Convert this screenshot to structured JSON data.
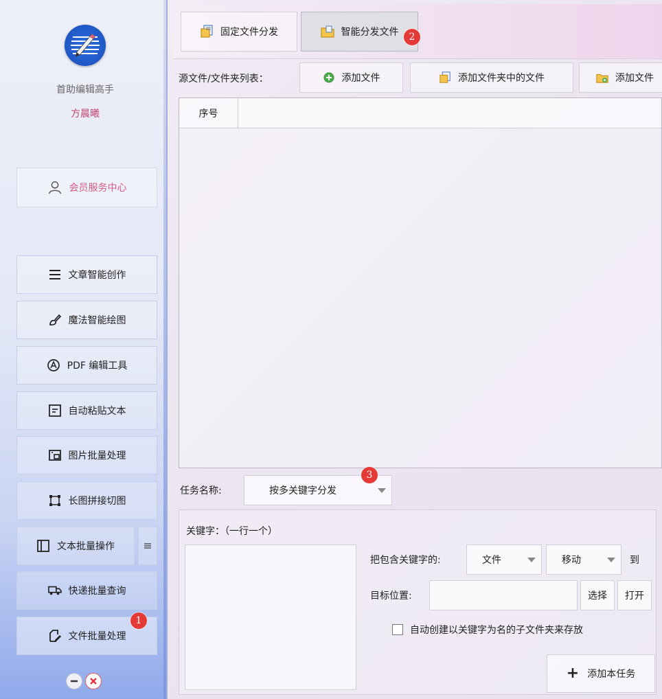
{
  "sidebar": {
    "app_name": "首助编辑高手",
    "user_name": "方晨曦",
    "member_center": "会员服务中心",
    "nav": [
      {
        "label": "文章智能创作",
        "icon": "list-icon"
      },
      {
        "label": "魔法智能绘图",
        "icon": "brush-icon"
      },
      {
        "label": "PDF 编辑工具",
        "icon": "pdf-icon"
      },
      {
        "label": "自动粘贴文本",
        "icon": "paste-icon"
      },
      {
        "label": "图片批量处理",
        "icon": "image-icon"
      },
      {
        "label": "长图拼接切图",
        "icon": "crop-icon"
      },
      {
        "label": "文本批量操作",
        "icon": "text-panel-icon"
      },
      {
        "label": "快递批量查询",
        "icon": "truck-icon"
      },
      {
        "label": "文件批量处理",
        "icon": "file-edit-icon"
      }
    ]
  },
  "tabs": [
    {
      "label": "固定文件分发",
      "active": false
    },
    {
      "label": "智能分发文件",
      "active": true
    }
  ],
  "toolbar": {
    "label": "源文件/文件夹列表：",
    "add_file": "添加文件",
    "add_folder_files": "添加文件夹中的文件",
    "add_folder": "添加文件"
  },
  "table": {
    "columns": [
      "序号"
    ],
    "rows": []
  },
  "task": {
    "label": "任务名称:",
    "value": "按多关键字分发"
  },
  "keywords": {
    "label": "关键字：（一行一个）",
    "value": ""
  },
  "rule": {
    "contains_label": "把包含关键字的:",
    "type_value": "文件",
    "action_value": "移动",
    "to_label": "到",
    "target_label": "目标位置:",
    "target_value": "",
    "choose": "选择",
    "open": "打开",
    "auto_create": "自动创建以关键字为名的子文件夹来存放",
    "add_task": "添加本任务"
  },
  "badges": [
    "1",
    "2",
    "3"
  ],
  "colors": {
    "accent_pink": "#c0456e",
    "badge_red": "#e53935",
    "logo_blue": "#1f57c4"
  }
}
